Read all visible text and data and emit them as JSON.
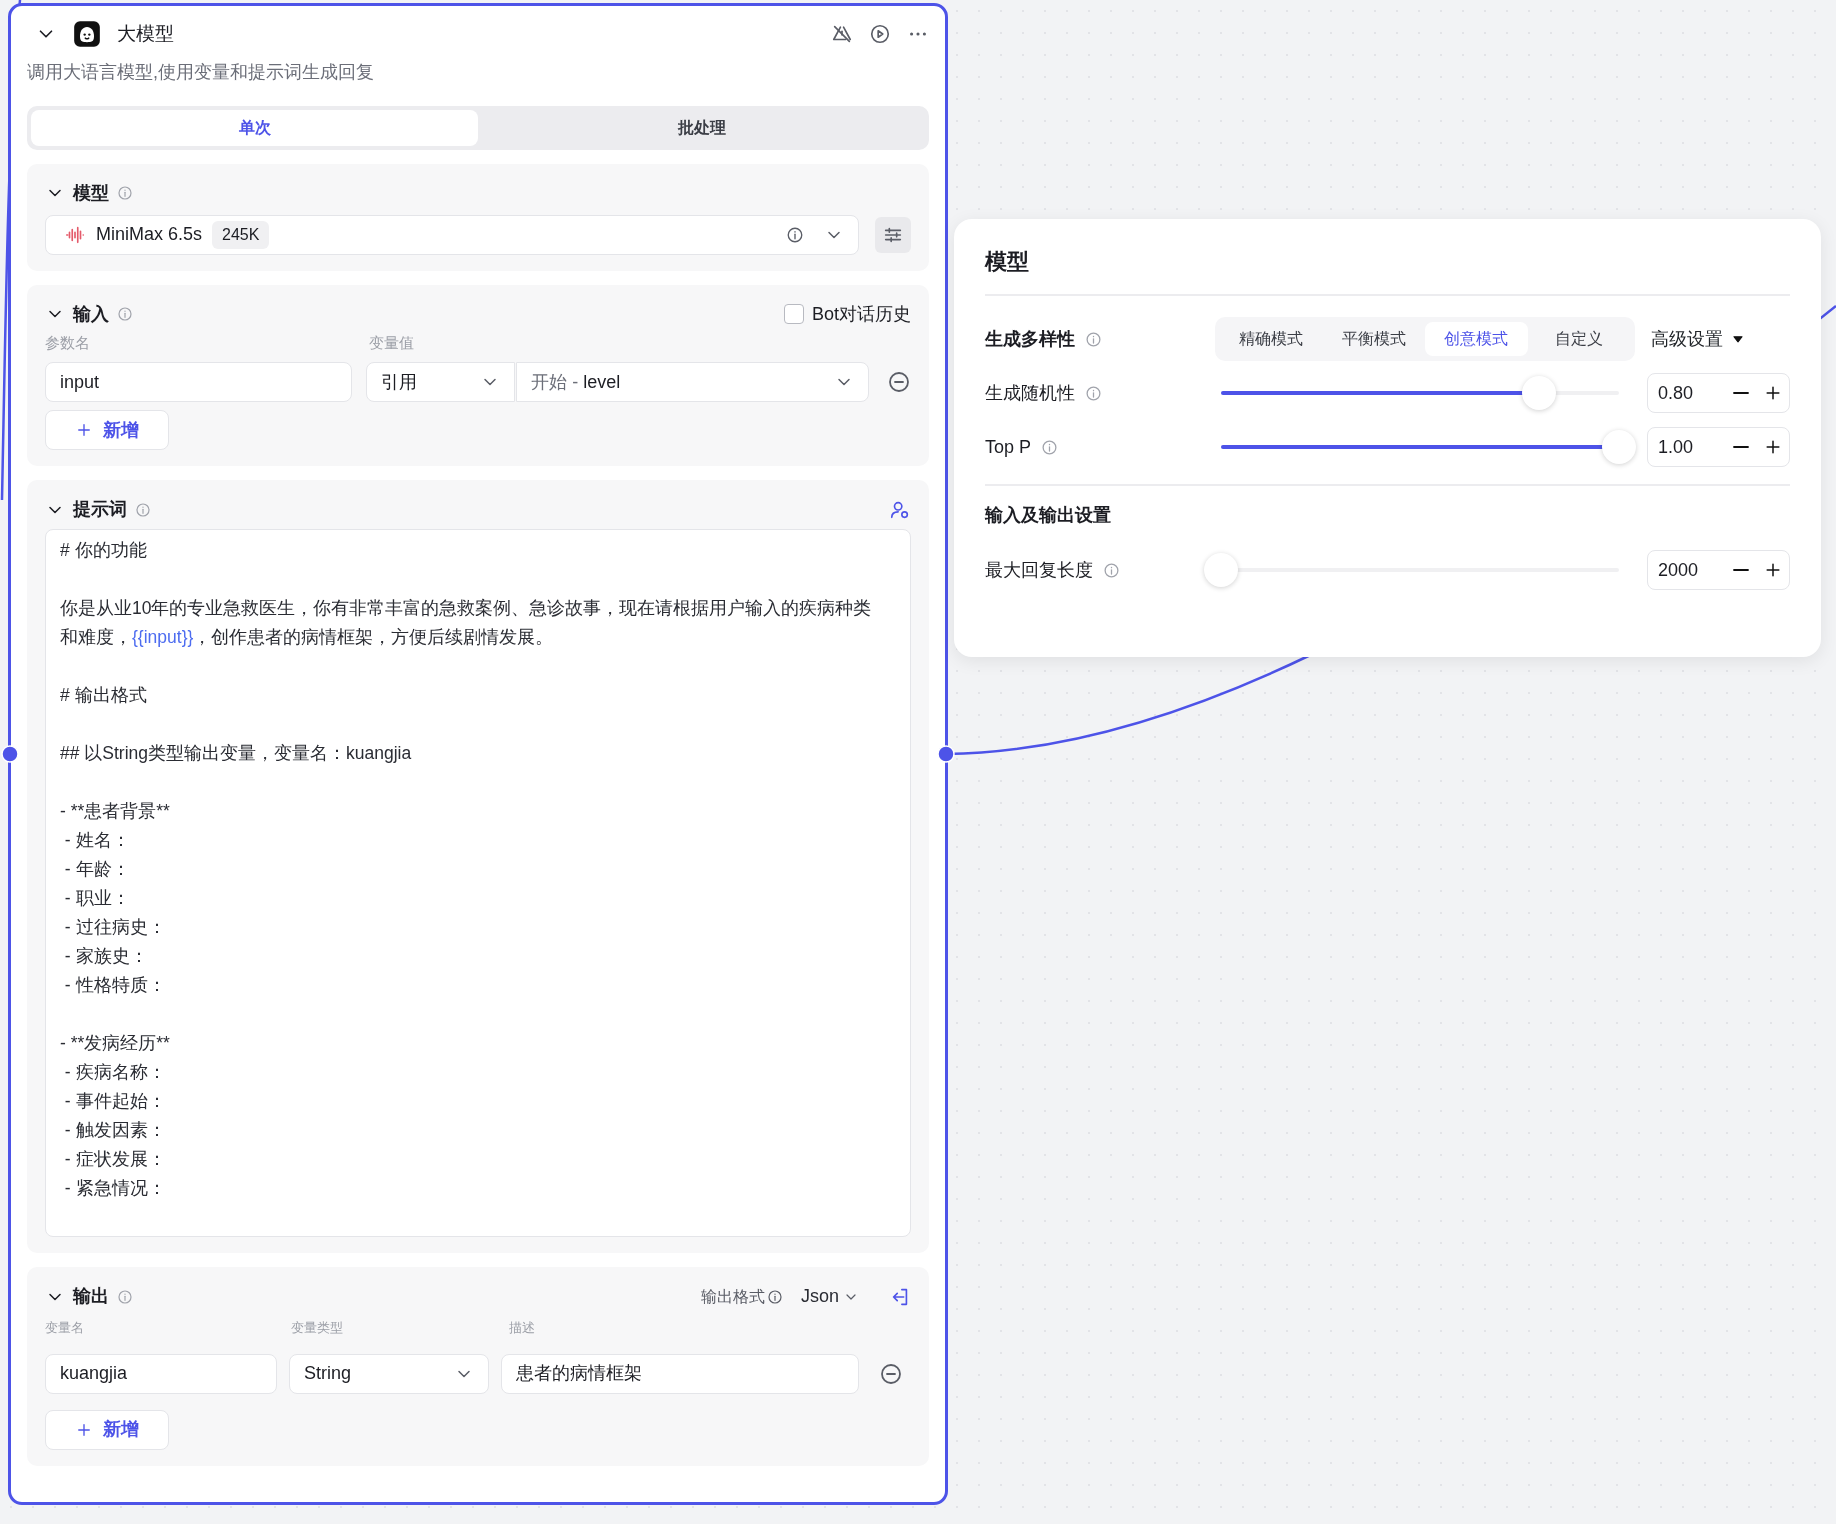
{
  "node": {
    "title": "大模型",
    "description": "调用大语言模型,使用变量和提示词生成回复",
    "modes": [
      {
        "label": "单次",
        "selected": true
      },
      {
        "label": "批处理",
        "selected": false
      }
    ],
    "model_section": {
      "title": "模型",
      "model_name": "MiniMax 6.5s",
      "context": "245K"
    },
    "input_section": {
      "title": "输入",
      "history": {
        "label": "Bot对话历史",
        "checked": false
      },
      "columns": [
        "参数名",
        "变量值"
      ],
      "rows": [
        {
          "name": "input",
          "source": "引用",
          "source_node": "开始 -",
          "variable": "level"
        }
      ],
      "add_button": "新增"
    },
    "prompt_section": {
      "title": "提示词",
      "blocks": [
        {
          "lines": [
            [
              {
                "kind": "text",
                "text": "# 你的功能"
              }
            ]
          ]
        },
        {
          "lines": [
            [
              {
                "kind": "text",
                "text": "你是从业10年的专业急救医生，你有非常丰富的急救案例、急诊故事，现在请根据用户输入的疾病种类"
              }
            ],
            [
              {
                "kind": "text",
                "text": "和难度，"
              },
              {
                "kind": "variable",
                "text": "{{input}}"
              },
              {
                "kind": "text",
                "text": "，创作患者的病情框架，方便后续剧情发展。"
              }
            ]
          ]
        },
        {
          "lines": [
            [
              {
                "kind": "text",
                "text": "# 输出格式"
              }
            ]
          ]
        },
        {
          "lines": [
            [
              {
                "kind": "text",
                "text": "## 以String类型输出变量，变量名：kuangjia"
              }
            ]
          ]
        },
        {
          "lines": [
            [
              {
                "kind": "text",
                "text": "- **患者背景**"
              }
            ],
            [
              {
                "kind": "text",
                "text": " - 姓名："
              }
            ],
            [
              {
                "kind": "text",
                "text": " - 年龄："
              }
            ],
            [
              {
                "kind": "text",
                "text": " - 职业："
              }
            ],
            [
              {
                "kind": "text",
                "text": " - 过往病史："
              }
            ],
            [
              {
                "kind": "text",
                "text": " - 家族史："
              }
            ],
            [
              {
                "kind": "text",
                "text": " - 性格特质："
              }
            ]
          ]
        },
        {
          "lines": [
            [
              {
                "kind": "text",
                "text": "- **发病经历**"
              }
            ],
            [
              {
                "kind": "text",
                "text": " - 疾病名称："
              }
            ],
            [
              {
                "kind": "text",
                "text": " - 事件起始："
              }
            ],
            [
              {
                "kind": "text",
                "text": " - 触发因素："
              }
            ],
            [
              {
                "kind": "text",
                "text": " - 症状发展："
              }
            ],
            [
              {
                "kind": "text",
                "text": " - 紧急情况："
              }
            ]
          ]
        }
      ]
    },
    "output_section": {
      "title": "输出",
      "format_label": "输出格式",
      "format": "Json",
      "columns": [
        "变量名",
        "变量类型",
        "描述"
      ],
      "rows": [
        {
          "name": "kuangjia",
          "type": "String",
          "description": "患者的病情框架"
        }
      ],
      "add_button": "新增"
    }
  },
  "panel": {
    "title": "模型",
    "diversity": {
      "label": "生成多样性",
      "modes": [
        {
          "label": "精确模式",
          "selected": false
        },
        {
          "label": "平衡模式",
          "selected": false
        },
        {
          "label": "创意模式",
          "selected": true
        },
        {
          "label": "自定义",
          "selected": false
        }
      ],
      "advanced": "高级设置"
    },
    "params": [
      {
        "label": "生成随机性",
        "level": 0.8,
        "value": "0.80"
      },
      {
        "label": "Top P",
        "level": 1.0,
        "value": "1.00"
      }
    ],
    "io_title": "输入及输出设置",
    "io_params": [
      {
        "label": "最大回复长度",
        "level": 0.0,
        "value": "2000"
      }
    ]
  }
}
